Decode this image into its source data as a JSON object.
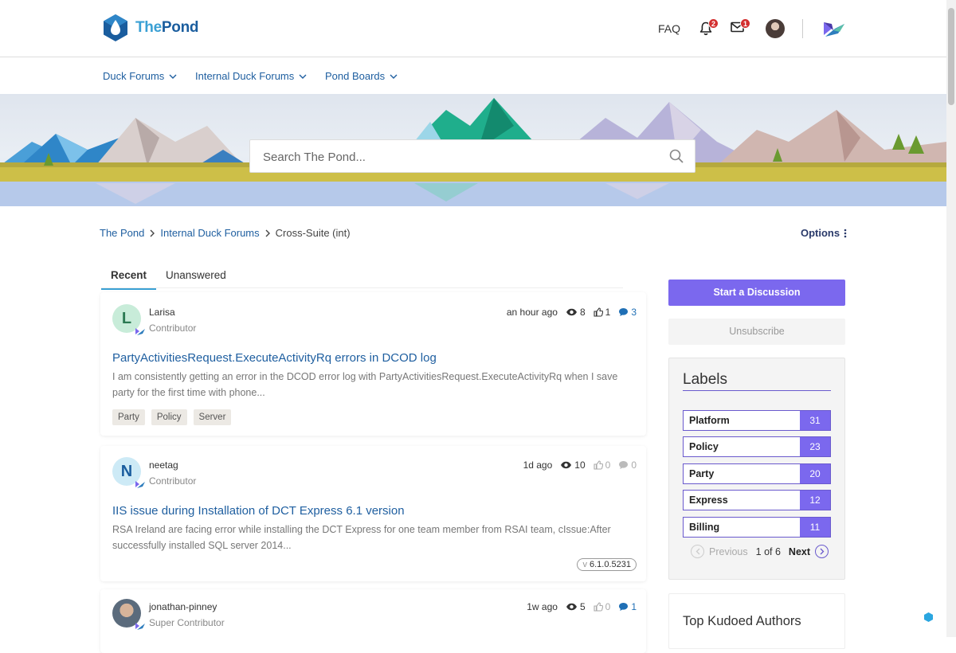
{
  "header": {
    "logo_word1": "The",
    "logo_word2": "Pond",
    "faq": "FAQ",
    "notifications_count": "2",
    "messages_count": "1"
  },
  "nav": {
    "items": [
      {
        "label": "Duck Forums"
      },
      {
        "label": "Internal Duck Forums"
      },
      {
        "label": "Pond Boards"
      }
    ]
  },
  "search": {
    "placeholder": "Search The Pond..."
  },
  "breadcrumb": {
    "items": [
      "The Pond",
      "Internal Duck Forums",
      "Cross-Suite (int)"
    ],
    "options": "Options"
  },
  "tabs": [
    "Recent",
    "Unanswered"
  ],
  "posts": [
    {
      "initial": "L",
      "avatar_color": "#c8ecd9",
      "author": "Larisa",
      "role": "Contributor",
      "time": "an hour ago",
      "views": "8",
      "kudos": "1",
      "replies": "3",
      "title": "PartyActivitiesRequest.ExecuteActivityRq errors in DCOD log",
      "body": "I am consistently getting an error in the DCOD error log with PartyActivitiesRequest.ExecuteActivityRq when I save party for the first time with phone...",
      "tags": [
        "Party",
        "Policy",
        "Server"
      ]
    },
    {
      "initial": "N",
      "avatar_color": "#cdeaf6",
      "author": "neetag",
      "role": "Contributor",
      "time": "1d ago",
      "views": "10",
      "kudos": "0",
      "replies": "0",
      "title": "IIS issue during Installation of DCT Express 6.1 version",
      "body": "RSA Ireland are facing error while installing the DCT Express for one team member from RSAI team, cIssue:After successfully installed SQL server 2014...",
      "version_prefix": "v",
      "version": "6.1.0.5231"
    },
    {
      "author": "jonathan-pinney",
      "role": "Super Contributor",
      "time": "1w ago",
      "views": "5",
      "kudos": "0",
      "replies": "1"
    }
  ],
  "sidebar": {
    "start_discussion": "Start a Discussion",
    "unsubscribe": "Unsubscribe",
    "labels_title": "Labels",
    "labels": [
      {
        "name": "Platform",
        "count": "31"
      },
      {
        "name": "Policy",
        "count": "23"
      },
      {
        "name": "Party",
        "count": "20"
      },
      {
        "name": "Express",
        "count": "12"
      },
      {
        "name": "Billing",
        "count": "11"
      }
    ],
    "pager": {
      "previous": "Previous",
      "page": "1 of 6",
      "next": "Next"
    },
    "top_kudoed": "Top Kudoed Authors"
  },
  "colors": {
    "accent": "#7b68ee",
    "link": "#1f5fa0",
    "tab_underline": "#3aa0d4",
    "badge": "#d32f2f"
  }
}
